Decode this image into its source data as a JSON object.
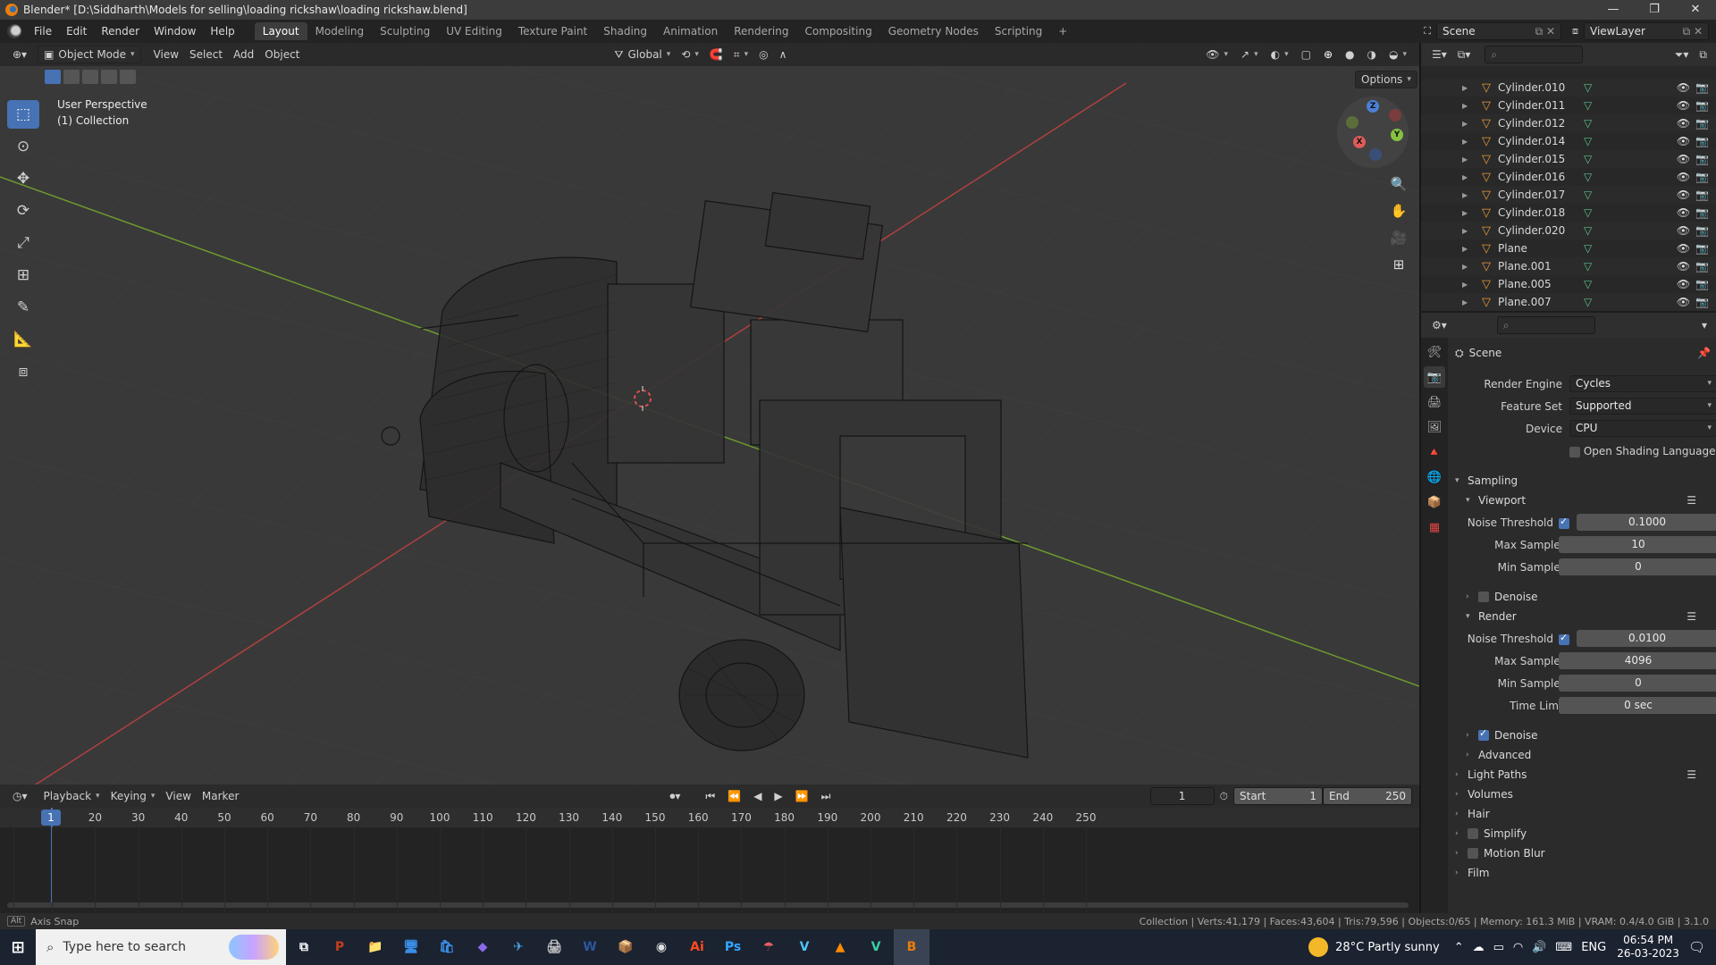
{
  "window": {
    "title": "Blender* [D:\\Siddharth\\Models for selling\\loading rickshaw\\loading rickshaw.blend]",
    "min": "—",
    "max": "❐",
    "close": "✕"
  },
  "menu": [
    "File",
    "Edit",
    "Render",
    "Window",
    "Help"
  ],
  "workspaces": [
    "Layout",
    "Modeling",
    "Sculpting",
    "UV Editing",
    "Texture Paint",
    "Shading",
    "Animation",
    "Rendering",
    "Compositing",
    "Geometry Nodes",
    "Scripting",
    "+"
  ],
  "scene": {
    "name": "Scene",
    "view_layer": "ViewLayer"
  },
  "viewport": {
    "mode": "Object Mode",
    "menus": [
      "View",
      "Select",
      "Add",
      "Object"
    ],
    "transform": "Global",
    "options_label": "Options",
    "info_line1": "User Perspective",
    "info_line2": "(1) Collection",
    "gizmo": {
      "z": "Z",
      "y": "Y",
      "x": "X"
    }
  },
  "outliner": {
    "rows": [
      {
        "name": "Cylinder.010"
      },
      {
        "name": "Cylinder.011"
      },
      {
        "name": "Cylinder.012"
      },
      {
        "name": "Cylinder.014"
      },
      {
        "name": "Cylinder.015"
      },
      {
        "name": "Cylinder.016"
      },
      {
        "name": "Cylinder.017"
      },
      {
        "name": "Cylinder.018"
      },
      {
        "name": "Cylinder.020"
      },
      {
        "name": "Plane"
      },
      {
        "name": "Plane.001"
      },
      {
        "name": "Plane.005"
      },
      {
        "name": "Plane.007"
      }
    ]
  },
  "properties": {
    "scene_label": "Scene",
    "render_engine_label": "Render Engine",
    "render_engine": "Cycles",
    "feature_set_label": "Feature Set",
    "feature_set": "Supported",
    "device_label": "Device",
    "device": "CPU",
    "osl_label": "Open Shading Language",
    "sampling": "Sampling",
    "viewport": "Viewport",
    "noise_threshold_label": "Noise Threshold",
    "vp_noise_threshold": "0.1000",
    "max_samples_label": "Max Samples",
    "vp_max_samples": "10",
    "min_samples_label": "Min Samples",
    "vp_min_samples": "0",
    "denoise_label": "Denoise",
    "render": "Render",
    "r_noise_threshold": "0.0100",
    "r_max_samples": "4096",
    "r_min_samples": "0",
    "time_limit_label": "Time Limit",
    "r_time_limit": "0 sec",
    "advanced": "Advanced",
    "light_paths": "Light Paths",
    "volumes": "Volumes",
    "hair": "Hair",
    "simplify": "Simplify",
    "motion_blur": "Motion Blur",
    "film": "Film"
  },
  "timeline": {
    "menus": [
      "Playback",
      "Keying",
      "View",
      "Marker"
    ],
    "current_frame": "1",
    "start_label": "Start",
    "start": "1",
    "end_label": "End",
    "end": "250",
    "ticks": [
      "1",
      "10",
      "20",
      "30",
      "40",
      "50",
      "60",
      "70",
      "80",
      "90",
      "100",
      "110",
      "120",
      "130",
      "140",
      "150",
      "160",
      "170",
      "180",
      "190",
      "200",
      "210",
      "220",
      "230",
      "240",
      "250"
    ]
  },
  "status": {
    "alt_key": "Alt",
    "left": "Axis Snap",
    "right": "Collection | Verts:41,179 | Faces:43,604 | Tris:79,596 | Objects:0/65 | Memory: 161.3 MiB | VRAM: 0.4/4.0 GiB | 3.1.0"
  },
  "taskbar": {
    "search_placeholder": "Type here to search",
    "weather": "28°C  Partly sunny",
    "lang": "ENG",
    "time": "06:54 PM",
    "date": "26-03-2023",
    "apps": [
      "P",
      "📁",
      "🖥",
      "🛍",
      "◆",
      "✈",
      "🖨",
      "W",
      "📦",
      "◉",
      "Ai",
      "Ps",
      "☂",
      "V",
      "▲",
      "V",
      "B"
    ]
  },
  "colors": {
    "accent": "#4772b3",
    "x_axis": "#b0403f",
    "y_axis": "#6c9a2e",
    "object_icon": "#e69a3a"
  }
}
